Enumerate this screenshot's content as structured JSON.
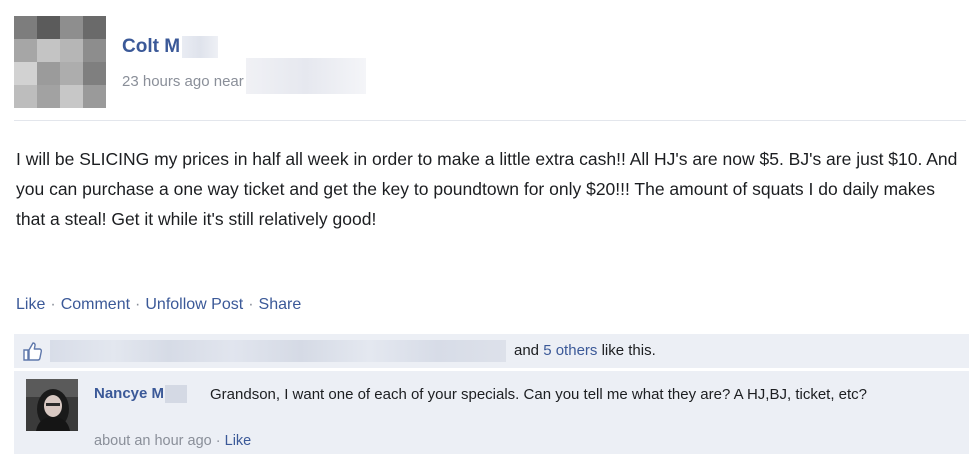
{
  "post": {
    "author": "Colt M",
    "timestamp": "23 hours ago near",
    "body": "I will be SLICING my prices in half all week in order to make a little extra cash!! All HJ's are now $5. BJ's are just $10. And you can purchase a one way ticket and get the key to poundtown for only $20!!! The amount of squats I do daily makes that a steal! Get it while it's still relatively good!",
    "actions": {
      "like": "Like",
      "comment": "Comment",
      "unfollow": "Unfollow Post",
      "share": "Share",
      "separator": "·"
    }
  },
  "likes": {
    "icon": "thumbs-up-icon",
    "prefix": "and",
    "others_link": "5 others",
    "suffix": "like this."
  },
  "comment": {
    "author": "Nancye M",
    "text": "Grandson, I want one of each of your specials. Can you tell me what they are? A HJ,BJ, ticket, etc?",
    "time": "about an hour ago",
    "separator": "·",
    "like": "Like"
  },
  "colors": {
    "link": "#3b5998",
    "meta": "#8a8f99",
    "bar_bg": "#eceff5"
  }
}
